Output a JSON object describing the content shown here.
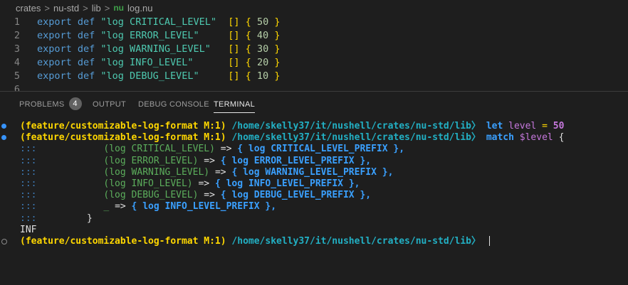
{
  "breadcrumb": {
    "items": [
      "crates",
      "nu-std",
      "lib"
    ],
    "file_icon": "nu",
    "file": "log.nu",
    "separator": ">"
  },
  "editor": {
    "lines": [
      {
        "num": "1",
        "keyword": "export def",
        "name": "\"log CRITICAL_LEVEL\"",
        "params": "[]",
        "open": "{",
        "value": "50",
        "close": "}"
      },
      {
        "num": "2",
        "keyword": "export def",
        "name": "\"log ERROR_LEVEL\"",
        "params": "[]",
        "open": "{",
        "value": "40",
        "close": "}"
      },
      {
        "num": "3",
        "keyword": "export def",
        "name": "\"log WARNING_LEVEL\"",
        "params": "[]",
        "open": "{",
        "value": "30",
        "close": "}"
      },
      {
        "num": "4",
        "keyword": "export def",
        "name": "\"log INFO_LEVEL\"",
        "params": "[]",
        "open": "{",
        "value": "20",
        "close": "}"
      },
      {
        "num": "5",
        "keyword": "export def",
        "name": "\"log DEBUG_LEVEL\"",
        "params": "[]",
        "open": "{",
        "value": "10",
        "close": "}"
      },
      {
        "num": "6",
        "keyword": "",
        "name": "",
        "params": "",
        "open": "",
        "value": "",
        "close": ""
      }
    ]
  },
  "panel": {
    "tabs": [
      {
        "label": "PROBLEMS",
        "badge": "4"
      },
      {
        "label": "OUTPUT"
      },
      {
        "label": "DEBUG CONSOLE"
      },
      {
        "label": "TERMINAL"
      }
    ]
  },
  "terminal": {
    "branch": "(feature/customizable-log-format M:1)",
    "path": "/home/skelly37/it/nushell/crates/nu-std/lib",
    "prompt_char": "〉",
    "cmd1": {
      "kw": "let",
      "var": "level",
      "op": "=",
      "num": "50"
    },
    "cmd2": {
      "kw": "match",
      "var": "$level",
      "brace": "{"
    },
    "continuation": ":::",
    "arms": [
      {
        "pattern": "(log CRITICAL_LEVEL)",
        "arrow": "=>",
        "open": "{",
        "call": "log CRITICAL_LEVEL_PREFIX",
        "close": "},"
      },
      {
        "pattern": "(log ERROR_LEVEL)",
        "arrow": "=>",
        "open": "{",
        "call": "log ERROR_LEVEL_PREFIX",
        "close": "},"
      },
      {
        "pattern": "(log WARNING_LEVEL)",
        "arrow": "=>",
        "open": "{",
        "call": "log WARNING_LEVEL_PREFIX",
        "close": "},"
      },
      {
        "pattern": "(log INFO_LEVEL)",
        "arrow": "=>",
        "open": "{",
        "call": "log INFO_LEVEL_PREFIX",
        "close": "},"
      },
      {
        "pattern": "(log DEBUG_LEVEL)",
        "arrow": "=>",
        "open": "{",
        "call": "log DEBUG_LEVEL_PREFIX",
        "close": "},"
      },
      {
        "pattern": "_",
        "arrow": "=>",
        "open": "{",
        "call": "log INFO_LEVEL_PREFIX",
        "close": "},"
      }
    ],
    "closing_brace": "}",
    "output": "INF"
  },
  "colors": {
    "background": "#1e1e1e",
    "branch": "#ffd700",
    "path": "#22b0c4",
    "keyword": "#3aa0ff",
    "variable": "#c678dd"
  }
}
